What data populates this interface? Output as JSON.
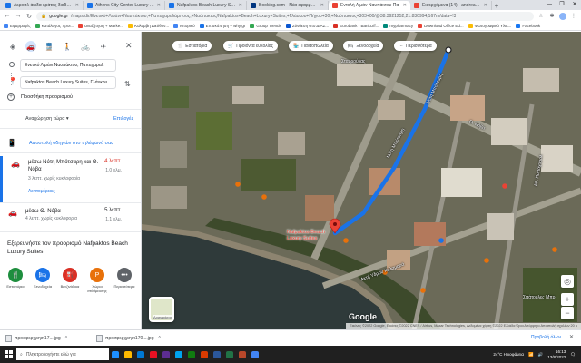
{
  "browser": {
    "tabs": [
      {
        "label": "Αεροπλ άκιδα κράτας διαδροτ",
        "color": "#1a73e8"
      },
      {
        "label": "Athens City Center Luxury Suite",
        "color": "#1a73e8"
      },
      {
        "label": "Nafpaktos Beach Luxury Suite",
        "color": "#1a73e8"
      },
      {
        "label": "Booking.com - Νέα εφαρμογή",
        "color": "#003580"
      },
      {
        "label": "Εντολή Λιμάν Ναυπάκτου Πα",
        "color": "#ea4335"
      },
      {
        "label": "Εισερχόμενα (14) - andreaskar",
        "color": "#ea4335"
      }
    ],
    "active_tab": 4,
    "new_tab": "+",
    "window_controls": [
      "—",
      "❐",
      "✕"
    ],
    "url_host": "google.gr",
    "url_path": "/maps/dir/Ενετικό+Λιμάνι+Ναυπάκτου,+Παπαχαραλάμπους,+Ναύπακτος/Nafpaktos+Beach+Luxury+Suites,+Γλάυκου+Πήγου+30,+Ναύπακτος+303+00/@38.3921252,21.830994,167m/data=!3",
    "bookmarks": [
      {
        "label": "Εφαρμογές",
        "color": "#4285f4"
      },
      {
        "label": "Κατάλογος προϊ...",
        "color": "#34a853"
      },
      {
        "label": "αναζήτηση + Marke...",
        "color": "#ea4335"
      },
      {
        "label": "Κολυμβη Διεύθυν...",
        "color": "#fbbc05"
      },
      {
        "label": "Ιστορικό",
        "color": "#4285f4"
      },
      {
        "label": "Επισκόπηση – why gr",
        "color": "#1a73e8"
      },
      {
        "label": "Group Trends",
        "color": "#34a853"
      },
      {
        "label": "Σύνδεση στο ΔΙΑΣ...",
        "color": "#0b57d0"
      },
      {
        "label": "Eurobank - BankOff...",
        "color": "#d93025"
      },
      {
        "label": "mypharmacy",
        "color": "#00897b"
      },
      {
        "label": "Download Office Ed...",
        "color": "#ea4335"
      },
      {
        "label": "Φωτογραφικό Υλικ...",
        "color": "#fbbc05"
      },
      {
        "label": "Facebook",
        "color": "#1877f2"
      }
    ]
  },
  "panel": {
    "origin": "Ενετικό Λιμάνι Ναυπάκτου, Παπαχαραλ",
    "destination": "Nafpaktos Beach Luxury Suites, Γλάυκου",
    "add_destination": "Προσθήκη προορισμού",
    "depart_label": "Αναχώρηση τώρα ▾",
    "options_label": "Επιλογές",
    "send_to_phone": "Αποστολή οδηγιών στο τηλέφωνό σας",
    "routes": [
      {
        "name": "μέσω Νότη Μπότσαρη και Θ. Νόβα",
        "time": "4 λεπτ.",
        "distance": "1,0 χλμ.",
        "sub": "3 λεπτ. χωρίς κυκλοφορία",
        "details": "Λεπτομέρειες"
      },
      {
        "name": "μέσω Θ. Νόβα",
        "time": "5 λεπτ.",
        "distance": "1,1 χλμ.",
        "sub": "4 λεπτ. χωρίς κυκλοφορία"
      }
    ],
    "explore_title": "Εξερευνήστε τον προορισμό Nafpaktos Beach Luxury Suites",
    "categories": [
      {
        "label": "Εστιατόρια",
        "color": "#1e8e3e",
        "icon": "🍴"
      },
      {
        "label": "Ξενοδοχεία",
        "color": "#1a73e8",
        "icon": "🛏"
      },
      {
        "label": "Βενζινάδικα",
        "color": "#d93025",
        "icon": "⛽"
      },
      {
        "label": "Χώροι στάθμευσης",
        "color": "#e8710a",
        "icon": "P"
      },
      {
        "label": "Περισσότερα",
        "color": "#5f6368",
        "icon": "•••"
      }
    ]
  },
  "map": {
    "chips": [
      {
        "label": "Εστιατόρια",
        "icon": "🍴"
      },
      {
        "label": "Προϊόντα ευκολίας",
        "icon": "🛒"
      },
      {
        "label": "Παντοπωλεία",
        "icon": "🏪"
      },
      {
        "label": "Ξενοδοχεία",
        "icon": "🛏"
      },
      {
        "label": "Περισσότερα",
        "icon": "⋯"
      }
    ],
    "destination_label": "Nafpaktos Beach Luxury Suites",
    "street_labels": [
      {
        "text": "Σταυρούλας"
      },
      {
        "text": "Νότη Μπότσαρη"
      },
      {
        "text": "Θ. Νόβα"
      },
      {
        "text": "Νότη Μπότσαρη"
      },
      {
        "text": "Αθ. Παπαχαραλ"
      },
      {
        "text": "Ακτή Υδρού Καλαμαρά"
      },
      {
        "text": "Σπάτουλες Μπρ"
      }
    ],
    "layers_label": "Δορυφόρος",
    "google_logo": "Google",
    "attribution": "Εικόνες ©2022 Google, Εικόνες ©2022 CNES / Airbus, Maxar Technologies, Δεδομένα χάρτη ©2022   Ελλάδα   Όροι   Απόρρητο   Αποστολή σχολίων   20 μ",
    "route_color": "#1a73e8"
  },
  "downloads": {
    "items": [
      "προσφερχρησι17....jpg",
      "προσφερχρησι170....jpg"
    ],
    "show_all": "Προβολή όλων",
    "close": "✕"
  },
  "taskbar": {
    "search_placeholder": "Πληκτρολογήστε εδώ για",
    "weather": "24°C  Ηλιοφάνεια",
    "time": "16:13",
    "date": "13/8/2022",
    "apps": [
      {
        "color": "#1e90ff"
      },
      {
        "color": "#ffb900"
      },
      {
        "color": "#0078d4"
      },
      {
        "color": "#e81123"
      },
      {
        "color": "#5c2d91"
      },
      {
        "color": "#00a4ef"
      },
      {
        "color": "#107c10"
      },
      {
        "color": "#d83b01"
      },
      {
        "color": "#2b579a"
      },
      {
        "color": "#217346"
      },
      {
        "color": "#b7472a"
      },
      {
        "color": "#4285f4"
      }
    ]
  }
}
